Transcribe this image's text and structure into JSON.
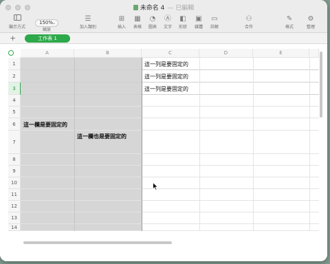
{
  "window": {
    "title": "未命名 4",
    "subtitle": "— 已編輯"
  },
  "toolbar": {
    "view_label": "顯示方式",
    "zoom_value": "150%",
    "zoom_label": "縮放",
    "add_category_label": "加入類別",
    "insert_label": "插入",
    "table_label": "表格",
    "chart_label": "圖表",
    "text_label": "文字",
    "shape_label": "形狀",
    "media_label": "媒體",
    "comment_label": "註解",
    "collaborate_label": "合作",
    "format_label": "格式",
    "organize_label": "整理"
  },
  "sheet": {
    "add_label": "+",
    "tab_label": "工作表 1"
  },
  "grid": {
    "columns": [
      "A",
      "B",
      "C",
      "D",
      "E"
    ],
    "rows": [
      "1",
      "2",
      "3",
      "4",
      "5",
      "6",
      "7",
      "8",
      "9",
      "10",
      "11",
      "12",
      "13",
      "14"
    ],
    "cells": {
      "c1": "這一列是要固定的",
      "c2": "這一列是要固定的",
      "c3": "這一列是要固定的",
      "a6": "這一欄是要固定的",
      "b7": "這一欄也是要固定的"
    }
  },
  "colors": {
    "accent": "#2da84a",
    "frozen_fill": "#d6d6d6",
    "desktop": "#7f9a8e"
  }
}
